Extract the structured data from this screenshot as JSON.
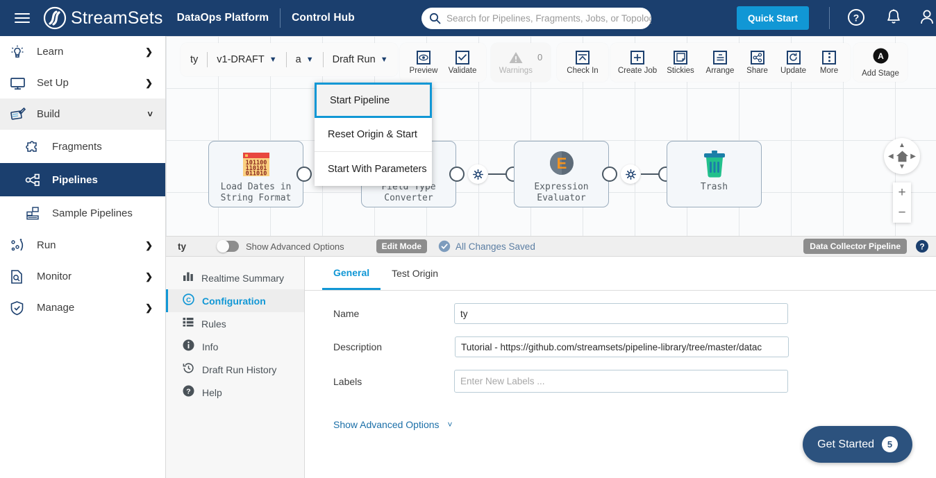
{
  "header": {
    "menu_icon": "hamburger-icon",
    "brand": "StreamSets",
    "product": "DataOps Platform",
    "section": "Control Hub",
    "search": {
      "placeholder": "Search for Pipelines, Fragments, Jobs, or Topologies",
      "value": "",
      "icon": "search-icon"
    },
    "quick_start": "Quick Start",
    "icons": [
      "help-icon",
      "notifications-bell-icon",
      "user-account-icon"
    ]
  },
  "sidebar": {
    "items": [
      {
        "label": "Learn",
        "icon": "lightbulb-icon",
        "state": "collapsed"
      },
      {
        "label": "Set Up",
        "icon": "monitor-icon",
        "state": "collapsed"
      },
      {
        "label": "Build",
        "icon": "build-icon",
        "state": "expanded"
      },
      {
        "label": "Fragments",
        "icon": "puzzle-icon",
        "state": "child"
      },
      {
        "label": "Pipelines",
        "icon": "pipeline-icon",
        "state": "child-active"
      },
      {
        "label": "Sample Pipelines",
        "icon": "sample-pipelines-icon",
        "state": "child"
      },
      {
        "label": "Run",
        "icon": "run-icon",
        "state": "collapsed"
      },
      {
        "label": "Monitor",
        "icon": "monitor-search-icon",
        "state": "collapsed"
      },
      {
        "label": "Manage",
        "icon": "shield-check-icon",
        "state": "collapsed"
      }
    ]
  },
  "pipeline_toolbar": {
    "pipeline_name": "ty",
    "version": "v1-DRAFT",
    "environment": "a",
    "run_mode": "Draft Run",
    "actions": [
      {
        "label": "Preview",
        "icon": "eye-icon",
        "disabled": false
      },
      {
        "label": "Validate",
        "icon": "checkmark-icon",
        "disabled": false
      },
      {
        "label": "Warnings",
        "icon": "warning-triangle-icon",
        "disabled": true,
        "count": "0"
      },
      {
        "label": "Check In",
        "icon": "check-in-icon",
        "disabled": false
      },
      {
        "label": "Create Job",
        "icon": "plus-icon",
        "disabled": false
      },
      {
        "label": "Stickies",
        "icon": "sticky-note-icon",
        "disabled": false
      },
      {
        "label": "Arrange",
        "icon": "arrange-icon",
        "disabled": false
      },
      {
        "label": "Share",
        "icon": "share-icon",
        "disabled": false
      },
      {
        "label": "Update",
        "icon": "refresh-icon",
        "disabled": false
      },
      {
        "label": "More",
        "icon": "more-vertical-icon",
        "disabled": false
      },
      {
        "label": "Add Stage",
        "icon": "add-stage-icon",
        "disabled": false
      }
    ]
  },
  "run_menu": {
    "items": [
      {
        "label": "Start Pipeline",
        "highlighted": true
      },
      {
        "label": "Reset Origin & Start",
        "highlighted": false
      },
      {
        "label": "Start With Parameters",
        "highlighted": false
      }
    ]
  },
  "canvas": {
    "stages": [
      {
        "label": "Load Dates in\nString Format",
        "line1": "Load Dates in",
        "line2": "String Format",
        "icon": "binary-data-icon"
      },
      {
        "label": "Field Type\nConverter",
        "line1": "Field Type",
        "line2": "Converter",
        "icon": "field-converter-icon"
      },
      {
        "label": "Expression\nEvaluator",
        "line1": "Expression",
        "line2": "Evaluator",
        "icon": "expression-evaluator-icon"
      },
      {
        "label": "Trash",
        "line1": "Trash",
        "line2": "",
        "icon": "trash-icon"
      }
    ],
    "controls": {
      "pan": "pan-home-icon",
      "zoom_in": "+",
      "zoom_out": "−"
    }
  },
  "statusbar": {
    "pipeline_name": "ty",
    "advanced_toggle_label": "Show Advanced Options",
    "advanced_toggle_on": false,
    "mode_chip": "Edit Mode",
    "save_status": "All Changes Saved",
    "save_icon": "check-circle-icon",
    "type_chip": "Data Collector Pipeline",
    "help_icon": "help-circle-icon"
  },
  "bottom_panel": {
    "nav": [
      {
        "label": "Realtime Summary",
        "icon": "bar-chart-icon",
        "selected": false
      },
      {
        "label": "Configuration",
        "icon": "configuration-icon",
        "selected": true
      },
      {
        "label": "Rules",
        "icon": "list-icon",
        "selected": false
      },
      {
        "label": "Info",
        "icon": "info-icon",
        "selected": false
      },
      {
        "label": "Draft Run History",
        "icon": "history-icon",
        "selected": false
      },
      {
        "label": "Help",
        "icon": "help-circle-icon",
        "selected": false
      }
    ],
    "tabs": [
      {
        "label": "General",
        "active": true
      },
      {
        "label": "Test Origin",
        "active": false
      }
    ],
    "fields": {
      "name_label": "Name",
      "name_value": "ty",
      "description_label": "Description",
      "description_value": "Tutorial - https://github.com/streamsets/pipeline-library/tree/master/datac",
      "labels_label": "Labels",
      "labels_value": "",
      "labels_placeholder": "Enter New Labels ..."
    },
    "advanced_link": "Show Advanced Options",
    "get_started": {
      "label": "Get Started",
      "count": "5"
    }
  },
  "colors": {
    "header_bg": "#1b3f6e",
    "accent_blue": "#1197d5",
    "active_nav": "#1b3f6e",
    "button_primary": "#2c527e"
  }
}
